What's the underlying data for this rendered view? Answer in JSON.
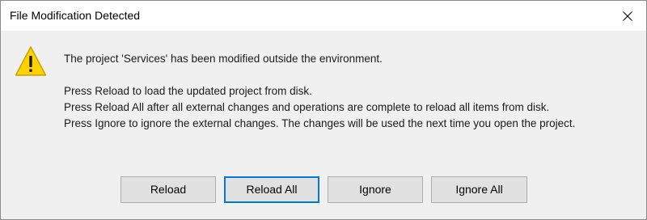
{
  "window": {
    "title": "File Modification Detected",
    "close_icon": "close-x-icon"
  },
  "icon": {
    "name": "warning-icon",
    "fill": "#ffd200",
    "stroke": "#c8a000"
  },
  "message": {
    "line1": "The project 'Services' has been modified outside the environment.",
    "line2": "Press Reload to load the updated project from disk.",
    "line3": "Press Reload All after all external changes and operations are complete to reload all items from disk.",
    "line4": "Press Ignore to ignore the external changes. The changes will be used the next time you open the project."
  },
  "buttons": {
    "reload": "Reload",
    "reload_all": "Reload All",
    "ignore": "Ignore",
    "ignore_all": "Ignore All"
  },
  "colors": {
    "focus_border": "#0078d7",
    "dialog_background": "#f0f0f0",
    "button_background": "#e1e1e1"
  }
}
